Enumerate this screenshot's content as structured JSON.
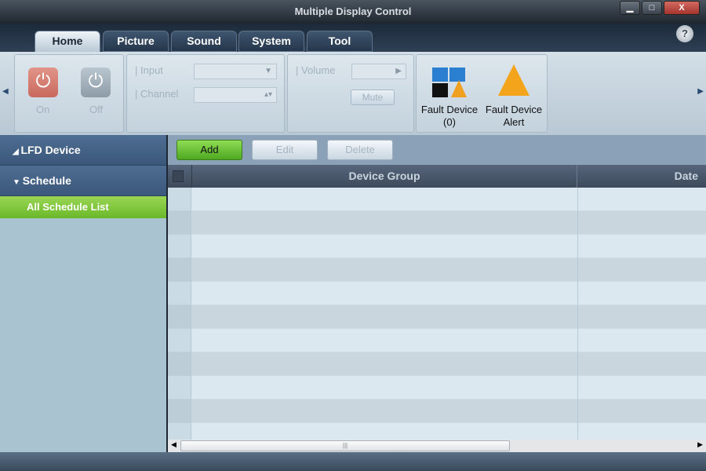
{
  "window": {
    "title": "Multiple Display Control",
    "minimize": "▁",
    "maximize": "□",
    "close": "X"
  },
  "tabs": [
    {
      "label": "Home",
      "active": true
    },
    {
      "label": "Picture"
    },
    {
      "label": "Sound"
    },
    {
      "label": "System"
    },
    {
      "label": "Tool"
    }
  ],
  "help": "?",
  "ribbon": {
    "on_label": "On",
    "off_label": "Off",
    "input_label": "Input",
    "channel_label": "Channel",
    "volume_label": "Volume",
    "mute_label": "Mute",
    "fault_device_label": "Fault Device",
    "fault_device_count": "(0)",
    "fault_alert_line1": "Fault Device",
    "fault_alert_line2": "Alert"
  },
  "sidebar": {
    "items": [
      {
        "label": "LFD Device",
        "icon": "triangle-collapsed"
      },
      {
        "label": "Schedule",
        "icon": "triangle-expanded"
      }
    ],
    "selected_sub": "All Schedule List"
  },
  "toolbar": {
    "add": "Add",
    "edit": "Edit",
    "delete": "Delete"
  },
  "table": {
    "columns": [
      "Device Group",
      "Date"
    ],
    "rows": []
  },
  "colors": {
    "accent_green": "#6bb82a",
    "header_blue": "#3b587b"
  }
}
